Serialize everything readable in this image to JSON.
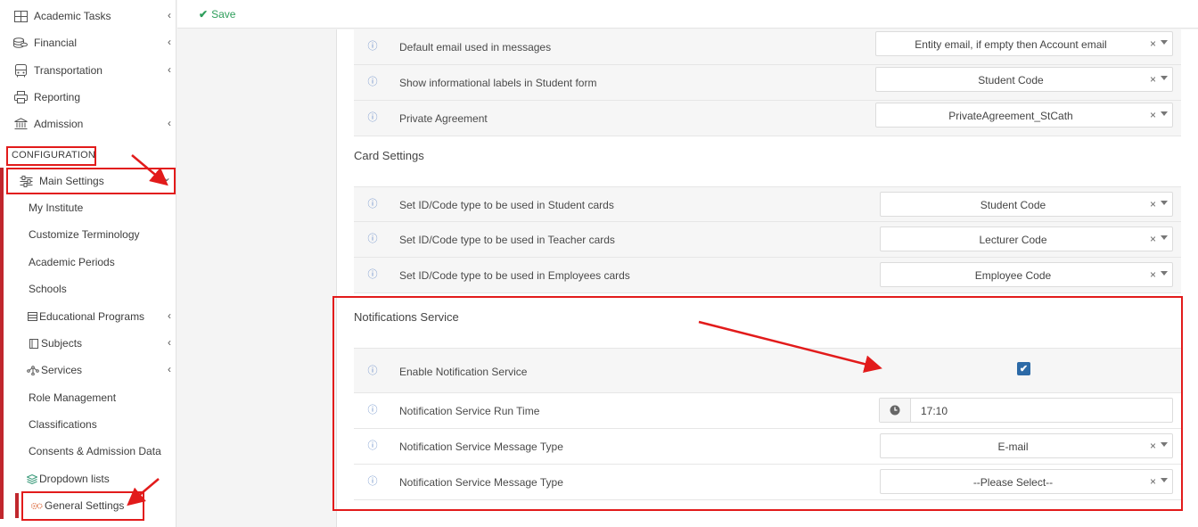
{
  "toolbar": {
    "save_label": "Save"
  },
  "sidebar": {
    "top_items": [
      {
        "label": "Academic Tasks",
        "icon": "table-icon"
      },
      {
        "label": "Financial",
        "icon": "coins-icon"
      },
      {
        "label": "Transportation",
        "icon": "bus-icon"
      },
      {
        "label": "Reporting",
        "icon": "printer-icon"
      },
      {
        "label": "Admission",
        "icon": "bank-icon"
      }
    ],
    "config_label": "CONFIGURATION",
    "main_settings_label": "Main Settings",
    "sub_items": [
      {
        "label": "My Institute"
      },
      {
        "label": "Customize Terminology"
      },
      {
        "label": "Academic Periods"
      },
      {
        "label": "Schools"
      },
      {
        "label": "Educational Programs"
      },
      {
        "label": "Subjects"
      },
      {
        "label": "Services"
      },
      {
        "label": "Role Management"
      },
      {
        "label": "Classifications"
      },
      {
        "label": "Consents & Admission Data"
      },
      {
        "label": "Dropdown lists"
      },
      {
        "label": "General Settings"
      }
    ]
  },
  "general": {
    "rows": [
      {
        "label": "Default email used in messages",
        "value": "Entity email, if empty then Account email"
      },
      {
        "label": "Show informational labels in Student form",
        "value": "Student Code"
      },
      {
        "label": "Private Agreement",
        "value": "PrivateAgreement_StCath"
      }
    ]
  },
  "card": {
    "title": "Card Settings",
    "rows": [
      {
        "label": "Set ID/Code type to be used in Student cards",
        "value": "Student Code"
      },
      {
        "label": "Set ID/Code type to be used in Teacher cards",
        "value": "Lecturer Code"
      },
      {
        "label": "Set ID/Code type to be used in Employees cards",
        "value": "Employee Code"
      }
    ]
  },
  "notifications": {
    "title": "Notifications Service",
    "enable_label": "Enable Notification Service",
    "enable_checked": true,
    "run_time_label": "Notification Service Run Time",
    "run_time_value": "17:10",
    "msg_type_label_1": "Notification Service Message Type",
    "msg_type_value_1": "E-mail",
    "msg_type_label_2": "Notification Service Message Type",
    "msg_type_value_2": "--Please Select--"
  },
  "glyphs": {
    "clear": "×",
    "check": "✔",
    "chevron_left": "‹",
    "chevron_down": "⌄",
    "info": "ⓘ"
  },
  "colors": {
    "accent_red": "#e21b1b",
    "save_green": "#2e9e5b",
    "checkbox_blue": "#2c6aa7",
    "sidebar_bar": "#c0272d"
  }
}
